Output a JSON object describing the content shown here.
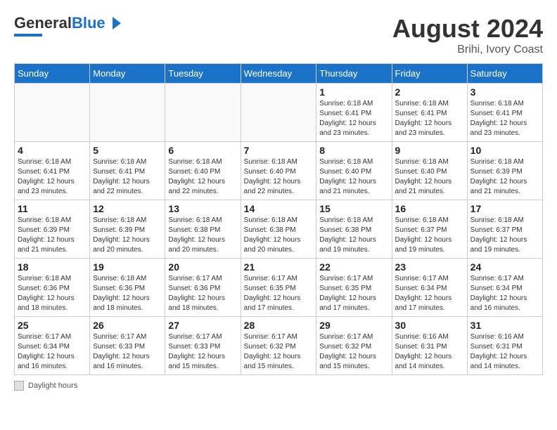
{
  "header": {
    "logo_general": "General",
    "logo_blue": "Blue",
    "month_title": "August 2024",
    "location": "Brihi, Ivory Coast"
  },
  "weekdays": [
    "Sunday",
    "Monday",
    "Tuesday",
    "Wednesday",
    "Thursday",
    "Friday",
    "Saturday"
  ],
  "footer": {
    "label": "Daylight hours"
  },
  "weeks": [
    [
      {
        "day": "",
        "info": ""
      },
      {
        "day": "",
        "info": ""
      },
      {
        "day": "",
        "info": ""
      },
      {
        "day": "",
        "info": ""
      },
      {
        "day": "1",
        "info": "Sunrise: 6:18 AM\nSunset: 6:41 PM\nDaylight: 12 hours\nand 23 minutes."
      },
      {
        "day": "2",
        "info": "Sunrise: 6:18 AM\nSunset: 6:41 PM\nDaylight: 12 hours\nand 23 minutes."
      },
      {
        "day": "3",
        "info": "Sunrise: 6:18 AM\nSunset: 6:41 PM\nDaylight: 12 hours\nand 23 minutes."
      }
    ],
    [
      {
        "day": "4",
        "info": "Sunrise: 6:18 AM\nSunset: 6:41 PM\nDaylight: 12 hours\nand 23 minutes."
      },
      {
        "day": "5",
        "info": "Sunrise: 6:18 AM\nSunset: 6:41 PM\nDaylight: 12 hours\nand 22 minutes."
      },
      {
        "day": "6",
        "info": "Sunrise: 6:18 AM\nSunset: 6:40 PM\nDaylight: 12 hours\nand 22 minutes."
      },
      {
        "day": "7",
        "info": "Sunrise: 6:18 AM\nSunset: 6:40 PM\nDaylight: 12 hours\nand 22 minutes."
      },
      {
        "day": "8",
        "info": "Sunrise: 6:18 AM\nSunset: 6:40 PM\nDaylight: 12 hours\nand 21 minutes."
      },
      {
        "day": "9",
        "info": "Sunrise: 6:18 AM\nSunset: 6:40 PM\nDaylight: 12 hours\nand 21 minutes."
      },
      {
        "day": "10",
        "info": "Sunrise: 6:18 AM\nSunset: 6:39 PM\nDaylight: 12 hours\nand 21 minutes."
      }
    ],
    [
      {
        "day": "11",
        "info": "Sunrise: 6:18 AM\nSunset: 6:39 PM\nDaylight: 12 hours\nand 21 minutes."
      },
      {
        "day": "12",
        "info": "Sunrise: 6:18 AM\nSunset: 6:39 PM\nDaylight: 12 hours\nand 20 minutes."
      },
      {
        "day": "13",
        "info": "Sunrise: 6:18 AM\nSunset: 6:38 PM\nDaylight: 12 hours\nand 20 minutes."
      },
      {
        "day": "14",
        "info": "Sunrise: 6:18 AM\nSunset: 6:38 PM\nDaylight: 12 hours\nand 20 minutes."
      },
      {
        "day": "15",
        "info": "Sunrise: 6:18 AM\nSunset: 6:38 PM\nDaylight: 12 hours\nand 19 minutes."
      },
      {
        "day": "16",
        "info": "Sunrise: 6:18 AM\nSunset: 6:37 PM\nDaylight: 12 hours\nand 19 minutes."
      },
      {
        "day": "17",
        "info": "Sunrise: 6:18 AM\nSunset: 6:37 PM\nDaylight: 12 hours\nand 19 minutes."
      }
    ],
    [
      {
        "day": "18",
        "info": "Sunrise: 6:18 AM\nSunset: 6:36 PM\nDaylight: 12 hours\nand 18 minutes."
      },
      {
        "day": "19",
        "info": "Sunrise: 6:18 AM\nSunset: 6:36 PM\nDaylight: 12 hours\nand 18 minutes."
      },
      {
        "day": "20",
        "info": "Sunrise: 6:17 AM\nSunset: 6:36 PM\nDaylight: 12 hours\nand 18 minutes."
      },
      {
        "day": "21",
        "info": "Sunrise: 6:17 AM\nSunset: 6:35 PM\nDaylight: 12 hours\nand 17 minutes."
      },
      {
        "day": "22",
        "info": "Sunrise: 6:17 AM\nSunset: 6:35 PM\nDaylight: 12 hours\nand 17 minutes."
      },
      {
        "day": "23",
        "info": "Sunrise: 6:17 AM\nSunset: 6:34 PM\nDaylight: 12 hours\nand 17 minutes."
      },
      {
        "day": "24",
        "info": "Sunrise: 6:17 AM\nSunset: 6:34 PM\nDaylight: 12 hours\nand 16 minutes."
      }
    ],
    [
      {
        "day": "25",
        "info": "Sunrise: 6:17 AM\nSunset: 6:34 PM\nDaylight: 12 hours\nand 16 minutes."
      },
      {
        "day": "26",
        "info": "Sunrise: 6:17 AM\nSunset: 6:33 PM\nDaylight: 12 hours\nand 16 minutes."
      },
      {
        "day": "27",
        "info": "Sunrise: 6:17 AM\nSunset: 6:33 PM\nDaylight: 12 hours\nand 15 minutes."
      },
      {
        "day": "28",
        "info": "Sunrise: 6:17 AM\nSunset: 6:32 PM\nDaylight: 12 hours\nand 15 minutes."
      },
      {
        "day": "29",
        "info": "Sunrise: 6:17 AM\nSunset: 6:32 PM\nDaylight: 12 hours\nand 15 minutes."
      },
      {
        "day": "30",
        "info": "Sunrise: 6:16 AM\nSunset: 6:31 PM\nDaylight: 12 hours\nand 14 minutes."
      },
      {
        "day": "31",
        "info": "Sunrise: 6:16 AM\nSunset: 6:31 PM\nDaylight: 12 hours\nand 14 minutes."
      }
    ]
  ]
}
